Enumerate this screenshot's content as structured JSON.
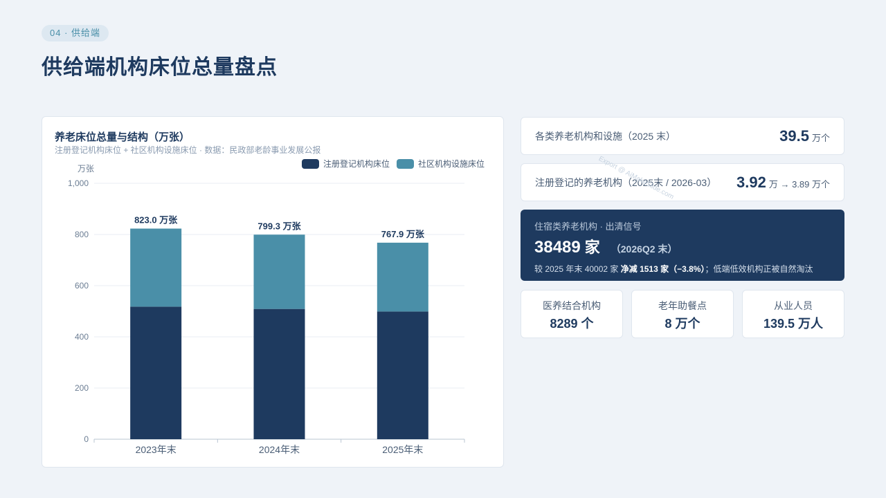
{
  "header": {
    "section_tag": "04 · 供给端",
    "title": "供给端机构床位总量盘点"
  },
  "colors": {
    "registered": "#1e3a5f",
    "community": "#4a8fa8",
    "grid": "#e8edf3",
    "axis_text": "#6b7d93"
  },
  "chart_data": {
    "type": "bar",
    "stacked": true,
    "title": "养老床位总量与结构（万张）",
    "subtitle": "注册登记机构床位 + 社区机构设施床位 · 数据：民政部老龄事业发展公报",
    "ylabel": "万张",
    "ylim": [
      0,
      1000
    ],
    "yticks": [
      "0",
      "200",
      "400",
      "600",
      "800",
      "1,000"
    ],
    "categories": [
      "2023年末",
      "2024年末",
      "2025年末"
    ],
    "series": [
      {
        "name": "注册登记机构床位",
        "values": [
          518,
          509,
          499
        ]
      },
      {
        "name": "社区机构设施床位",
        "values": [
          305,
          290.3,
          268.9
        ]
      }
    ],
    "totals": [
      823.0,
      799.3,
      767.9
    ],
    "total_labels": [
      "823.0 万张",
      "799.3 万张",
      "767.9 万张"
    ],
    "legend_position": "top-right",
    "grid": true
  },
  "stats": {
    "facilities": {
      "label": "各类养老机构和设施（2025 末）",
      "value": "39.5",
      "unit": "万个"
    },
    "registered": {
      "label": "注册登记的养老机构（2025末 / 2026-03）",
      "value": "3.92",
      "unit": "万 → 3.89 万个"
    }
  },
  "hero": {
    "label": "住宿类养老机构 · 出清信号",
    "value": "38489",
    "unit": "家",
    "period": "（2026Q2 末）",
    "note_prefix": "较 2025 年末 40002 家",
    "note_bold": "净减 1513 家（−3.8%）",
    "note_suffix": "；低端低效机构正被自然淘汰"
  },
  "mini": [
    {
      "label": "医养结合机构",
      "value": "8289 个"
    },
    {
      "label": "老年助餐点",
      "value": "8 万个"
    },
    {
      "label": "从业人员",
      "value": "139.5 万人"
    }
  ],
  "watermark": "Export @ AiMakeSlide.com"
}
